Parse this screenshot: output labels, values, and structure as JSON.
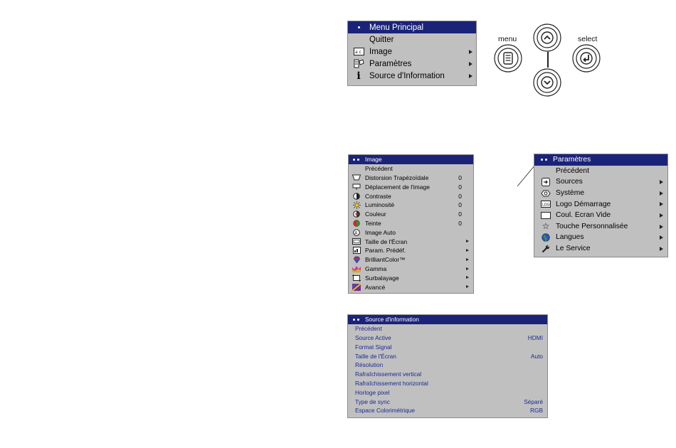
{
  "main_menu": {
    "title": "Menu Principal",
    "items": [
      {
        "label": "Quitter",
        "icon": "",
        "submenu": false
      },
      {
        "label": "Image",
        "icon": "image-icon",
        "submenu": true
      },
      {
        "label": "Paramètres",
        "icon": "settings-icon",
        "submenu": true
      },
      {
        "label": "Source d'Information",
        "icon": "info-icon",
        "submenu": true
      }
    ]
  },
  "remote": {
    "menu_label": "menu",
    "select_label": "select"
  },
  "image_menu": {
    "title": "Image",
    "items": [
      {
        "label": "Précédent",
        "icon": "",
        "value": "",
        "submenu": false
      },
      {
        "label": "Distorsion Trapézoïdale",
        "icon": "keystone-icon",
        "value": "0",
        "submenu": false
      },
      {
        "label": "Déplacement de l'image",
        "icon": "image-shift-icon",
        "value": "0",
        "submenu": false
      },
      {
        "label": "Contraste",
        "icon": "contrast-icon",
        "value": "0",
        "submenu": false
      },
      {
        "label": "Luminosité",
        "icon": "brightness-icon",
        "value": "0",
        "submenu": false
      },
      {
        "label": "Couleur",
        "icon": "color-icon",
        "value": "0",
        "submenu": false
      },
      {
        "label": "Teinte",
        "icon": "tint-icon",
        "value": "0",
        "submenu": false
      },
      {
        "label": "Image Auto",
        "icon": "auto-image-icon",
        "value": "",
        "submenu": false
      },
      {
        "label": "Taille de l'Écran",
        "icon": "screen-size-icon",
        "value": "",
        "submenu": true
      },
      {
        "label": "Param. Prédéf.",
        "icon": "presets-icon",
        "value": "",
        "submenu": true
      },
      {
        "label": "BrilliantColor™",
        "icon": "brilliantcolor-icon",
        "value": "",
        "submenu": true
      },
      {
        "label": "Gamma",
        "icon": "gamma-icon",
        "value": "",
        "submenu": true
      },
      {
        "label": "Surbalayage",
        "icon": "overscan-icon",
        "value": "",
        "submenu": true
      },
      {
        "label": "Avancé",
        "icon": "advanced-icon",
        "value": "",
        "submenu": true
      }
    ]
  },
  "settings_menu": {
    "title": "Paramètres",
    "items": [
      {
        "label": "Précédent",
        "icon": "",
        "submenu": false
      },
      {
        "label": "Sources",
        "icon": "sources-icon",
        "submenu": true
      },
      {
        "label": "Système",
        "icon": "system-icon",
        "submenu": true
      },
      {
        "label": "Logo Démarrage",
        "icon": "startup-logo-icon",
        "submenu": true
      },
      {
        "label": "Coul. Écran Vide",
        "icon": "blank-screen-icon",
        "submenu": true
      },
      {
        "label": "Touche Personnalisée",
        "icon": "star-icon",
        "submenu": true
      },
      {
        "label": "Langues",
        "icon": "globe-icon",
        "submenu": true
      },
      {
        "label": "Le Service",
        "icon": "wrench-icon",
        "submenu": true
      }
    ]
  },
  "info_menu": {
    "title": "Source d'information",
    "items": [
      {
        "label": "Précédent",
        "value": ""
      },
      {
        "label": "Source Active",
        "value": "HDMI"
      },
      {
        "label": "Format Signal",
        "value": ""
      },
      {
        "label": "Taille de l'Écran",
        "value": "Auto"
      },
      {
        "label": "Résolution",
        "value": ""
      },
      {
        "label": "Rafraîchissement vertical",
        "value": ""
      },
      {
        "label": "Rafraîchissement horizontal",
        "value": ""
      },
      {
        "label": "Horloge pixel",
        "value": ""
      },
      {
        "label": "Type de sync",
        "value": "Séparé"
      },
      {
        "label": "Espace Colorimétrique",
        "value": "RGB"
      }
    ]
  },
  "colors": {
    "menu_bg": "#c0c0c0",
    "header_bg": "#1b2379",
    "info_text": "#1c2a8f"
  }
}
